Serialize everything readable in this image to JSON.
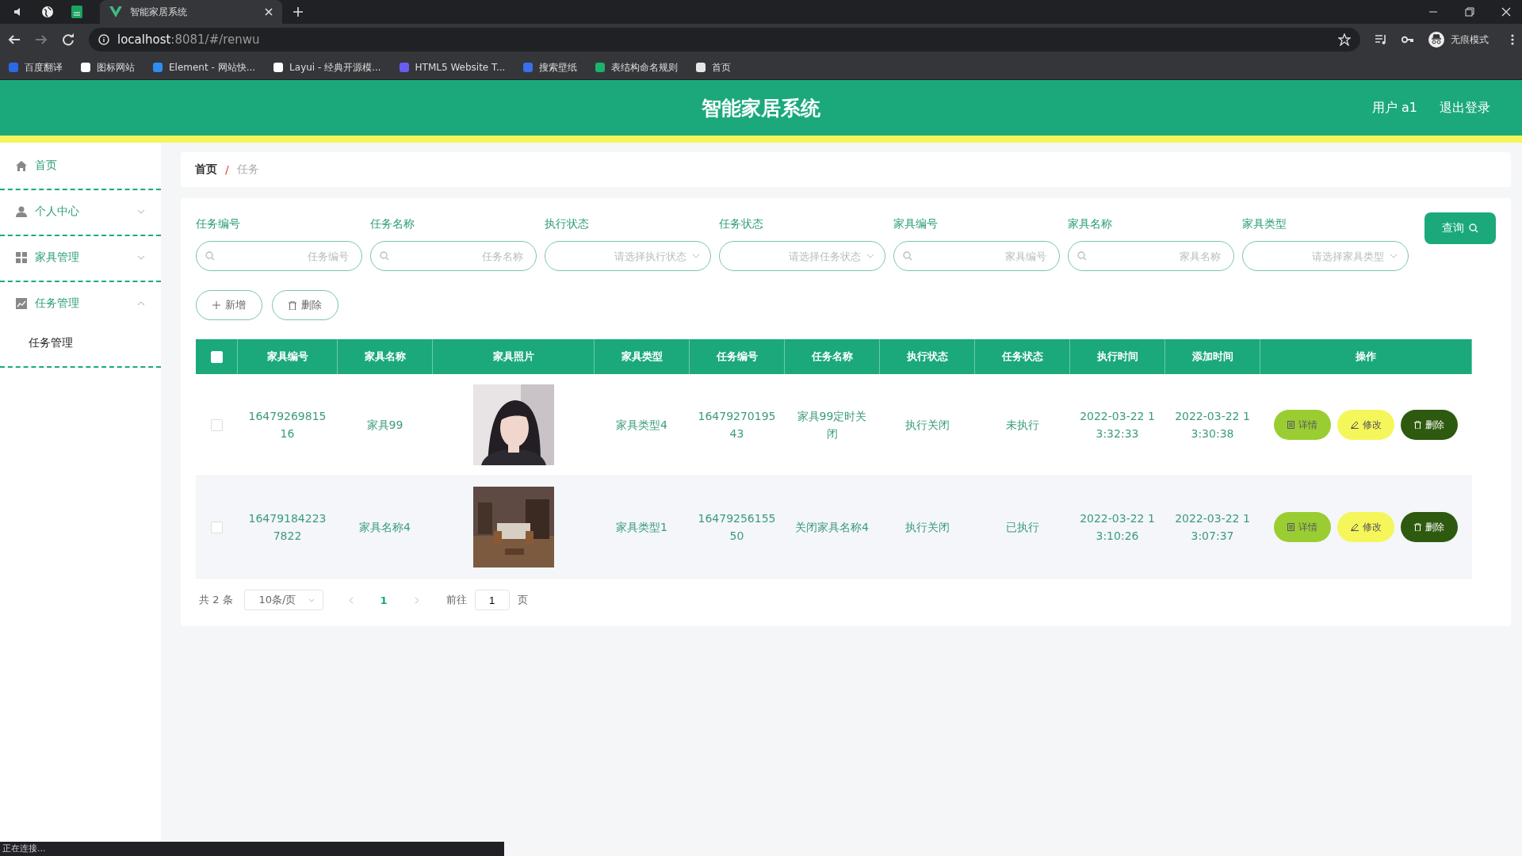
{
  "browser": {
    "tab_title": "智能家居系统",
    "address_host": "localhost",
    "address_rest": ":8081/#/renwu",
    "profile": "无痕模式",
    "bookmarks": [
      "百度翻译",
      "图标网站",
      "Element - 网站快...",
      "Layui - 经典开源模...",
      "HTML5 Website T...",
      "搜索壁纸",
      "表结构命名规则",
      "首页"
    ]
  },
  "header": {
    "title": "智能家居系统",
    "user": "用户 a1",
    "logout": "退出登录"
  },
  "sidebar": [
    {
      "label": "首页"
    },
    {
      "label": "个人中心",
      "expanded": false
    },
    {
      "label": "家具管理",
      "expanded": false
    },
    {
      "label": "任务管理",
      "expanded": true,
      "children": [
        {
          "label": "任务管理"
        }
      ]
    }
  ],
  "breadcrumb": [
    "首页",
    "任务"
  ],
  "breadcrumb_separator": "/",
  "filters": [
    {
      "label": "任务编号",
      "kind": "text",
      "placeholder": "任务编号"
    },
    {
      "label": "任务名称",
      "kind": "text",
      "placeholder": "任务名称"
    },
    {
      "label": "执行状态",
      "kind": "select",
      "placeholder": "请选择执行状态"
    },
    {
      "label": "任务状态",
      "kind": "select",
      "placeholder": "请选择任务状态"
    },
    {
      "label": "家具编号",
      "kind": "text",
      "placeholder": "家具编号"
    },
    {
      "label": "家具名称",
      "kind": "text",
      "placeholder": "家具名称"
    },
    {
      "label": "家具类型",
      "kind": "select",
      "placeholder": "请选择家具类型"
    }
  ],
  "query_button": "查询",
  "actions": [
    "新增",
    "删除"
  ],
  "table": {
    "all_checked": false,
    "columns": [
      "家具编号",
      "家具名称",
      "家具照片",
      "家具类型",
      "任务编号",
      "任务名称",
      "执行状态",
      "任务状态",
      "执行时间",
      "添加时间",
      "操作"
    ],
    "rows": [
      {
        "checked": false,
        "cells": [
          "1647926981516",
          "家具99",
          {
            "kind": "picture"
          },
          "家具类型4",
          "1647927019543",
          "家具99定时关闭",
          "执行关闭",
          "未执行",
          "2022-03-22 13:32:33",
          "2022-03-22 13:30:38"
        ],
        "buttons": [
          "详情",
          "修改",
          "删除"
        ]
      },
      {
        "checked": false,
        "cells": [
          "164791842237822",
          "家具名称4",
          {
            "kind": "picture"
          },
          "家具类型1",
          "1647925615550",
          "关闭家具名称4",
          "执行关闭",
          "已执行",
          "2022-03-22 13:10:26",
          "2022-03-22 13:07:37"
        ],
        "buttons": [
          "详情",
          "修改",
          "删除"
        ]
      }
    ]
  },
  "pagination": {
    "total": "共 2 条",
    "page_size": "10条/页",
    "pages": [
      {
        "label": "1",
        "selected": true
      }
    ],
    "goto": "前往",
    "goto_value": "1",
    "page_unit": "页"
  },
  "status_bar": "正在连接..."
}
